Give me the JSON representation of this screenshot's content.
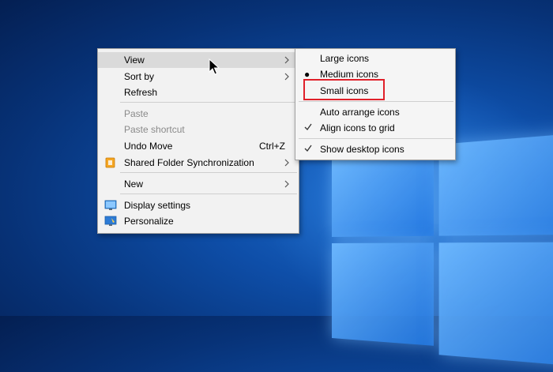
{
  "desktop": {
    "accent": "#0e4ea8"
  },
  "context_menu": {
    "items": [
      {
        "label": "View",
        "has_submenu": true,
        "state": "hover"
      },
      {
        "label": "Sort by",
        "has_submenu": true
      },
      {
        "label": "Refresh"
      },
      {
        "label": "Paste",
        "disabled": true
      },
      {
        "label": "Paste shortcut",
        "disabled": true
      },
      {
        "label": "Undo Move",
        "accelerator": "Ctrl+Z"
      },
      {
        "label": "Shared Folder Synchronization",
        "has_submenu": true,
        "icon": "sync-app-icon"
      },
      {
        "label": "New",
        "has_submenu": true
      },
      {
        "label": "Display settings",
        "icon": "display-settings-icon"
      },
      {
        "label": "Personalize",
        "icon": "personalize-icon"
      }
    ]
  },
  "view_submenu": {
    "items": [
      {
        "label": "Large icons"
      },
      {
        "label": "Medium icons",
        "mark": "bullet"
      },
      {
        "label": "Small icons",
        "highlighted": true
      },
      {
        "label": "Auto arrange icons"
      },
      {
        "label": "Align icons to grid",
        "mark": "check"
      },
      {
        "label": "Show desktop icons",
        "mark": "check"
      }
    ],
    "highlight_color": "#e0202a"
  }
}
